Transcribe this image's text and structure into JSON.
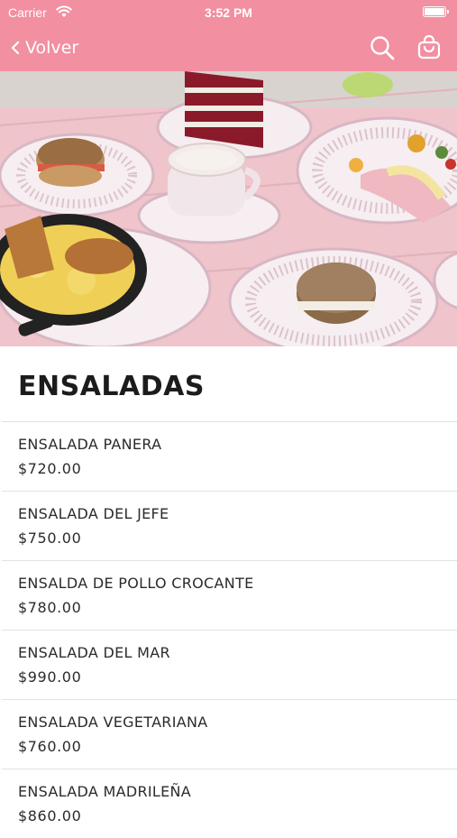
{
  "status_bar": {
    "carrier": "Carrier",
    "time": "3:52 PM"
  },
  "nav": {
    "back_label": "Volver",
    "search_icon": "search-icon",
    "cart_icon": "shopping-bag-icon"
  },
  "colors": {
    "header_pink": "#f28fa1",
    "text_dark": "#1c1c1c",
    "divider": "#e2e2e2"
  },
  "section": {
    "title": "ENSALADAS"
  },
  "items": [
    {
      "name": "ENSALADA PANERA",
      "price": "$720.00"
    },
    {
      "name": "ENSALADA DEL JEFE",
      "price": "$750.00"
    },
    {
      "name": "ENSALDA DE POLLO CROCANTE",
      "price": "$780.00"
    },
    {
      "name": "ENSALADA DEL MAR",
      "price": "$990.00"
    },
    {
      "name": "ENSALADA VEGETARIANA",
      "price": "$760.00"
    },
    {
      "name": "ENSALADA MADRILEÑA",
      "price": "$860.00"
    }
  ]
}
